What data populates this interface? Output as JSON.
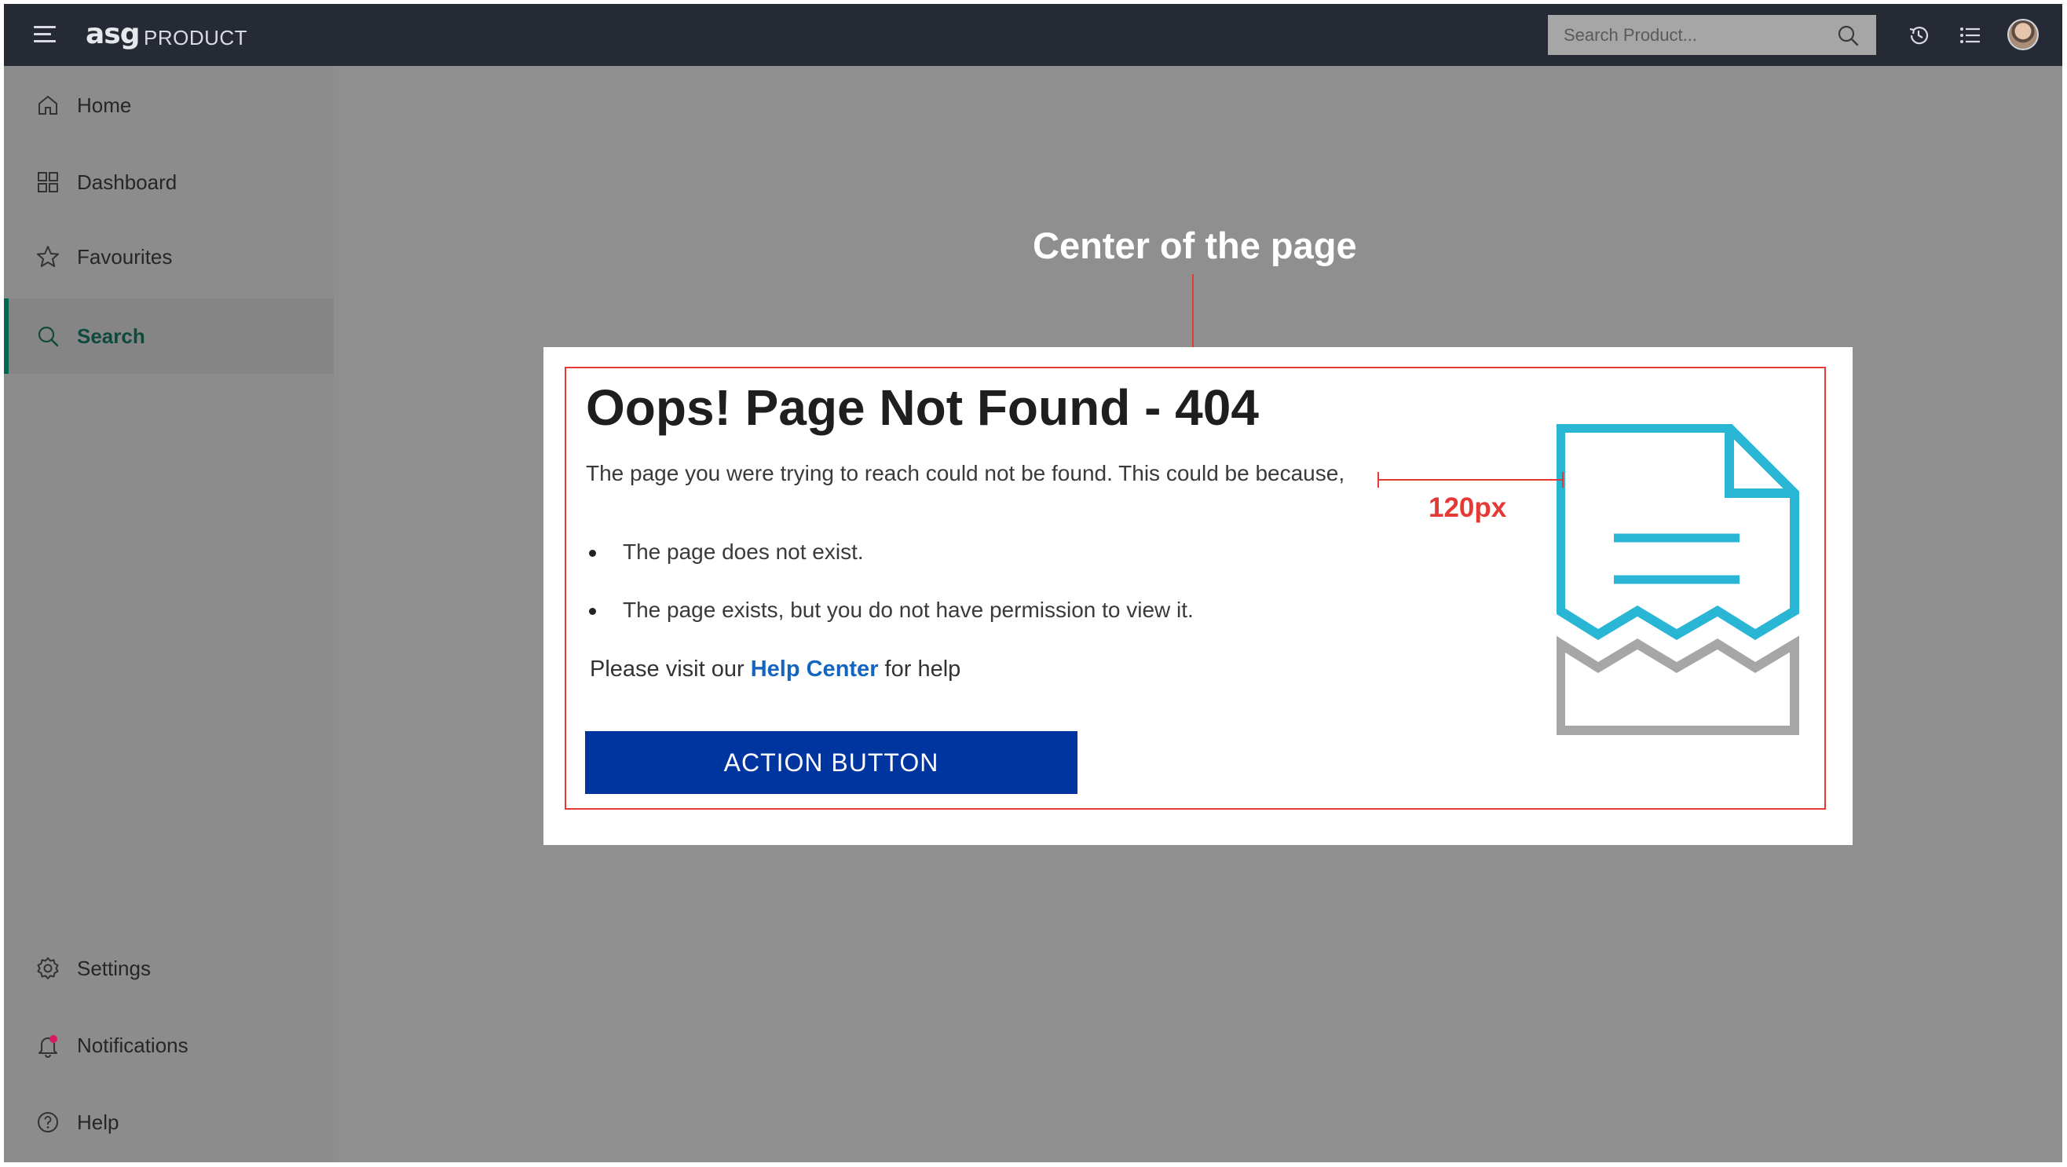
{
  "header": {
    "logo_text": "asg",
    "product_name": "PRODUCT",
    "search_placeholder": "Search Product...",
    "icons": [
      "menu-icon",
      "search-icon",
      "history-icon",
      "list-icon",
      "avatar"
    ]
  },
  "sidebar": {
    "top_items": [
      {
        "label": "Home",
        "icon": "home-icon"
      },
      {
        "label": "Dashboard",
        "icon": "dashboard-icon"
      },
      {
        "label": "Favourites",
        "icon": "star-icon"
      },
      {
        "label": "Search",
        "icon": "search-icon",
        "active": true
      }
    ],
    "bottom_items": [
      {
        "label": "Settings",
        "icon": "gear-icon"
      },
      {
        "label": "Notifications",
        "icon": "bell-icon",
        "has_badge": true
      },
      {
        "label": "Help",
        "icon": "help-icon"
      }
    ]
  },
  "error_card": {
    "title": "Oops! Page Not Found - 404",
    "description": "The page you were trying to reach could not be found. This could be because,",
    "reasons": [
      "The page does not exist.",
      "The page exists, but you do not have permission to view it."
    ],
    "help_prefix": "Please visit our",
    "help_link": "Help Center",
    "help_suffix": "for help",
    "action_button": "ACTION BUTTON",
    "illustration": "torn-document-illustration"
  },
  "annotations": {
    "center_label": "Center of the page",
    "spacing_label": "120px"
  },
  "colors": {
    "topbar": "#262a35",
    "overlay": "#8f8f8f",
    "active_accent": "#00664f",
    "action_button": "#0035a0",
    "link": "#1565c0",
    "illustration_primary": "#29b6d4",
    "illustration_secondary": "#a6a6a6",
    "annotation": "#e53935",
    "notification_badge": "#d81b60"
  }
}
